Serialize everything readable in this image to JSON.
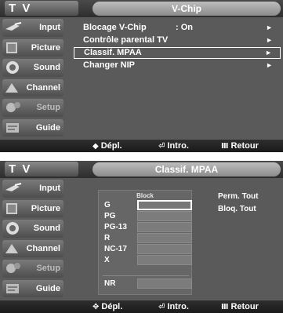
{
  "panel1": {
    "tv_label": "T V",
    "title": "V-Chip",
    "sidebar": [
      {
        "label": "Input",
        "icon": "input-icon"
      },
      {
        "label": "Picture",
        "icon": "picture-icon"
      },
      {
        "label": "Sound",
        "icon": "sound-icon"
      },
      {
        "label": "Channel",
        "icon": "channel-icon"
      },
      {
        "label": "Setup",
        "icon": "setup-icon"
      },
      {
        "label": "Guide",
        "icon": "guide-icon"
      }
    ],
    "menu": [
      {
        "label": "Blocage V-Chip",
        "value": ": On",
        "arrow": "►"
      },
      {
        "label": "Contrôle parental TV",
        "value": "",
        "arrow": "►"
      },
      {
        "label": "Classif. MPAA",
        "value": "",
        "arrow": "►"
      },
      {
        "label": "Changer NIP",
        "value": "",
        "arrow": "►"
      }
    ],
    "bottom": {
      "move_icon": "◆",
      "move": "Dépl.",
      "enter_icon": "⏎",
      "enter": "Intro.",
      "return_icon": "Ⅲ",
      "return": "Retour"
    }
  },
  "panel2": {
    "tv_label": "T V",
    "title": "Classif. MPAA",
    "sidebar": [
      {
        "label": "Input",
        "icon": "input-icon"
      },
      {
        "label": "Picture",
        "icon": "picture-icon"
      },
      {
        "label": "Sound",
        "icon": "sound-icon"
      },
      {
        "label": "Channel",
        "icon": "channel-icon"
      },
      {
        "label": "Setup",
        "icon": "setup-icon"
      },
      {
        "label": "Guide",
        "icon": "guide-icon"
      }
    ],
    "block_header": "Block",
    "ratings": [
      "G",
      "PG",
      "PG-13",
      "R",
      "NC-17",
      "X"
    ],
    "nr_label": "NR",
    "allow_all": "Perm. Tout",
    "block_all": "Bloq. Tout",
    "bottom": {
      "move_icon": "✥",
      "move": "Dépl.",
      "enter_icon": "⏎",
      "enter": "Intro.",
      "return_icon": "Ⅲ",
      "return": "Retour"
    }
  }
}
